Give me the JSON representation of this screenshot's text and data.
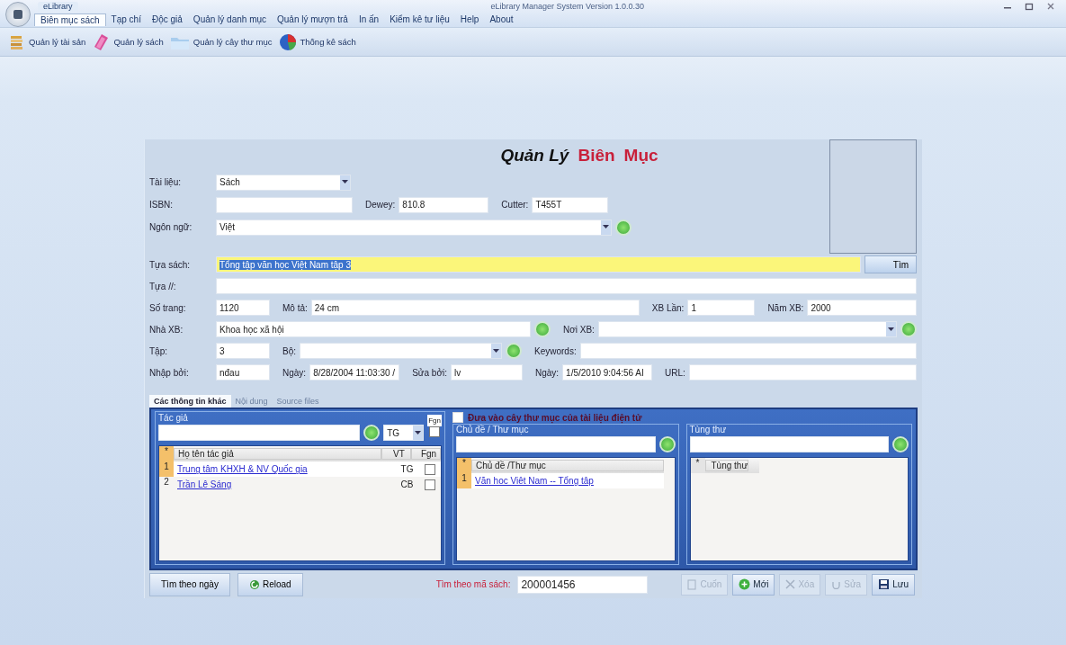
{
  "window": {
    "app_tab": "eLibrary",
    "title": "eLibrary Manager System Version 1.0.0.30"
  },
  "menu": [
    {
      "label": "Biên mục sách",
      "selected": true
    },
    {
      "label": "Tạp chí",
      "selected": false
    },
    {
      "label": "Độc giả",
      "selected": false
    },
    {
      "label": "Quản lý danh mục",
      "selected": false
    },
    {
      "label": "Quản lý mượn trả",
      "selected": false
    },
    {
      "label": "In ấn",
      "selected": false
    },
    {
      "label": "Kiểm kê tư liệu",
      "selected": false
    },
    {
      "label": "Help",
      "selected": false
    },
    {
      "label": "About",
      "selected": false
    }
  ],
  "toolbar": [
    {
      "label": "Quản lý tài sản",
      "kind": "stack"
    },
    {
      "label": "Quản lý sách",
      "kind": "book"
    },
    {
      "label": "Quản lý cây thư mục",
      "kind": "folder"
    },
    {
      "label": "Thống kê sách",
      "kind": "chart"
    }
  ],
  "form": {
    "heading": [
      "Quản Lý",
      "Biên",
      "Mục"
    ],
    "rows": [
      {
        "items": [
          {
            "kind": "label",
            "text": "Tài liệu:"
          },
          {
            "kind": "select",
            "value": "Sách"
          }
        ]
      },
      {
        "items": [
          {
            "kind": "label",
            "text": "ISBN:"
          },
          {
            "kind": "input"
          },
          {
            "kind": "label",
            "text": "Dewey:"
          },
          {
            "kind": "input",
            "value": "810.8"
          },
          {
            "kind": "label",
            "text": "Cutter:"
          },
          {
            "kind": "input",
            "value": "T455T"
          }
        ]
      },
      {
        "items": [
          {
            "kind": "label",
            "text": "Ngôn ngữ:"
          },
          {
            "kind": "select",
            "value": "Việt"
          },
          {
            "kind": "lookup"
          }
        ]
      },
      {
        "items": [
          {
            "kind": "label",
            "text": "Tựa sách:"
          },
          {
            "kind": "input",
            "value": "Tổng tập văn học Việt Nam tập 3",
            "focused": true
          },
          {
            "kind": "button",
            "text": "Tìm"
          }
        ]
      },
      {
        "items": [
          {
            "kind": "label",
            "text": "Tựa //:"
          },
          {
            "kind": "input"
          }
        ]
      },
      {
        "items": [
          {
            "kind": "label",
            "text": "Số trang:"
          },
          {
            "kind": "input",
            "value": "1120"
          },
          {
            "kind": "label",
            "text": "Mô tả:"
          },
          {
            "kind": "input",
            "value": "24 cm"
          },
          {
            "kind": "label",
            "text": "XB Lần:"
          },
          {
            "kind": "input",
            "value": "1"
          },
          {
            "kind": "label",
            "text": "Năm XB:"
          },
          {
            "kind": "input",
            "value": "2000"
          }
        ]
      },
      {
        "items": [
          {
            "kind": "label",
            "text": "Nhà XB:"
          },
          {
            "kind": "input",
            "value": "Khoa học xã hội"
          },
          {
            "kind": "lookup"
          },
          {
            "kind": "label",
            "text": "Nơi XB:"
          },
          {
            "kind": "select"
          },
          {
            "kind": "lookup"
          }
        ]
      },
      {
        "items": [
          {
            "kind": "label",
            "text": "Tập:"
          },
          {
            "kind": "input",
            "value": "3"
          },
          {
            "kind": "label",
            "text": "Bộ:"
          },
          {
            "kind": "select"
          },
          {
            "kind": "lookup"
          },
          {
            "kind": "label",
            "text": "Keywords:"
          },
          {
            "kind": "input"
          }
        ]
      },
      {
        "items": [
          {
            "kind": "label",
            "text": "Nhập bởi:"
          },
          {
            "kind": "input",
            "value": "nđau"
          },
          {
            "kind": "label",
            "text": "Ngày:"
          },
          {
            "kind": "input",
            "value": "8/28/2004 11:03:30 /"
          },
          {
            "kind": "label",
            "text": "Sửa bởi:"
          },
          {
            "kind": "input",
            "value": "lv"
          },
          {
            "kind": "label",
            "text": "Ngày:"
          },
          {
            "kind": "input",
            "value": "1/5/2010 9:04:56 AI"
          },
          {
            "kind": "label",
            "text": "URL:"
          },
          {
            "kind": "input"
          }
        ]
      }
    ]
  },
  "tabs": [
    {
      "label": "Các thông tin khác",
      "selected": true
    },
    {
      "label": "Nội dung",
      "selected": false
    },
    {
      "label": "Source files",
      "selected": false
    }
  ],
  "authors": {
    "legend": "Tác giả",
    "role": "TG",
    "fgn_label": "Fgn",
    "fgn_checked": false,
    "columns": [
      "*",
      "Họ tên tác giả",
      "VT",
      "Fgn"
    ],
    "rows": [
      {
        "no": "1",
        "name": "Trung tâm KHXH & NV Quốc gia",
        "role": "TG",
        "fgn": false,
        "selected": true
      },
      {
        "no": "2",
        "name": "Trần Lê Sáng",
        "role": "CB",
        "fgn": false,
        "selected": false
      }
    ]
  },
  "catalog": {
    "checkbox": {
      "label": "Đưa vào cây thư mục của tài liệu điện tử",
      "checked": false
    },
    "subjects": {
      "legend": "Chủ đề / Thư mục",
      "columns": [
        "*",
        "Chủ đề /Thư mục"
      ],
      "rows": [
        {
          "no": "1",
          "name": "Văn học Việt Nam -- Tổng tập",
          "selected": true
        }
      ]
    },
    "series": {
      "legend": "Tùng thư",
      "columns": [
        "*",
        "Tùng thư"
      ]
    }
  },
  "bottom": {
    "date_search": "Tìm theo ngày",
    "reload": "Reload",
    "code_label": "Tìm theo mã sách:",
    "code_value": "200001456",
    "actions": [
      {
        "label": "Cuốn",
        "kind": "copy",
        "disabled": true
      },
      {
        "label": "Mới",
        "kind": "new",
        "disabled": false
      },
      {
        "label": "Xóa",
        "kind": "delete",
        "disabled": true
      },
      {
        "label": "Sửa",
        "kind": "edit",
        "disabled": true
      },
      {
        "label": "Lưu",
        "kind": "save",
        "disabled": false
      }
    ]
  }
}
